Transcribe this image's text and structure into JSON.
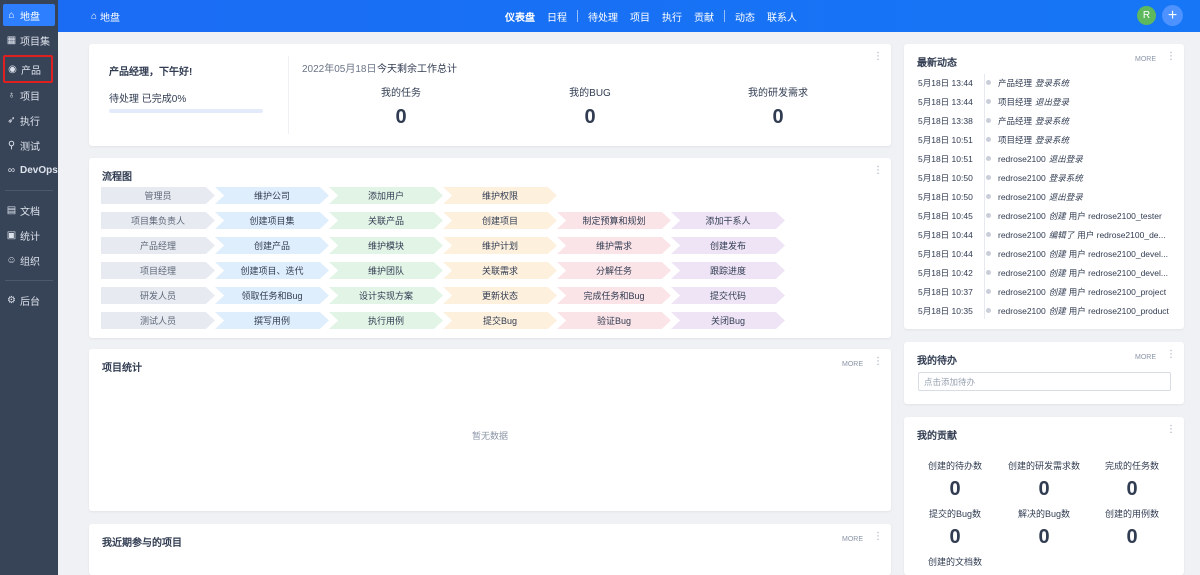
{
  "sidebar": {
    "items": [
      {
        "label": "地盘",
        "icon": "home-icon"
      },
      {
        "label": "项目集",
        "icon": "grid-icon"
      },
      {
        "label": "产品",
        "icon": "location-icon"
      },
      {
        "label": "项目",
        "icon": "bell-icon"
      },
      {
        "label": "执行",
        "icon": "rocket-icon"
      },
      {
        "label": "测试",
        "icon": "search-icon"
      },
      {
        "label": "DevOps",
        "icon": "infinity-icon"
      },
      {
        "label": "文档",
        "icon": "document-icon"
      },
      {
        "label": "统计",
        "icon": "chart-icon"
      },
      {
        "label": "组织",
        "icon": "people-icon"
      },
      {
        "label": "后台",
        "icon": "gear-icon"
      }
    ]
  },
  "topbar": {
    "crumb": "地盘",
    "nav": [
      "仪表盘",
      "日程",
      "待处理",
      "项目",
      "执行",
      "贡献",
      "动态",
      "联系人"
    ],
    "active_nav": "仪表盘",
    "avatar": "R",
    "plus": "+"
  },
  "welcome": {
    "greeting": "产品经理，下午好!",
    "todo_progress": "待处理 已完成0%",
    "date": "2022年05月18日",
    "date_note": "今天剩余工作总计",
    "stats": [
      {
        "label": "我的任务",
        "value": "0"
      },
      {
        "label": "我的BUG",
        "value": "0"
      },
      {
        "label": "我的研发需求",
        "value": "0"
      }
    ]
  },
  "flow": {
    "title": "流程图",
    "rows": [
      [
        "管理员",
        "维护公司",
        "添加用户",
        "维护权限"
      ],
      [
        "项目集负责人",
        "创建项目集",
        "关联产品",
        "创建项目",
        "制定预算和规划",
        "添加干系人"
      ],
      [
        "产品经理",
        "创建产品",
        "维护模块",
        "维护计划",
        "维护需求",
        "创建发布"
      ],
      [
        "项目经理",
        "创建项目、迭代",
        "维护团队",
        "关联需求",
        "分解任务",
        "跟踪进度"
      ],
      [
        "研发人员",
        "领取任务和Bug",
        "设计实现方案",
        "更新状态",
        "完成任务和Bug",
        "提交代码"
      ],
      [
        "测试人员",
        "撰写用例",
        "执行用例",
        "提交Bug",
        "验证Bug",
        "关闭Bug"
      ]
    ]
  },
  "project_stats": {
    "title": "项目统计",
    "more": "MORE",
    "empty": "暂无数据"
  },
  "recent_projects": {
    "title": "我近期参与的项目",
    "more": "MORE"
  },
  "dynamics": {
    "title": "最新动态",
    "more": "MORE",
    "items": [
      {
        "time": "5月18日 13:44",
        "who": "产品经理",
        "action": "登录系统",
        "object": ""
      },
      {
        "time": "5月18日 13:44",
        "who": "项目经理",
        "action": "退出登录",
        "object": ""
      },
      {
        "time": "5月18日 13:38",
        "who": "产品经理",
        "action": "登录系统",
        "object": ""
      },
      {
        "time": "5月18日 10:51",
        "who": "项目经理",
        "action": "登录系统",
        "object": ""
      },
      {
        "time": "5月18日 10:51",
        "who": "redrose2100",
        "action": "退出登录",
        "object": ""
      },
      {
        "time": "5月18日 10:50",
        "who": "redrose2100",
        "action": "登录系统",
        "object": ""
      },
      {
        "time": "5月18日 10:50",
        "who": "redrose2100",
        "action": "退出登录",
        "object": ""
      },
      {
        "time": "5月18日 10:45",
        "who": "redrose2100",
        "action": "创建",
        "object": "用户 redrose2100_tester"
      },
      {
        "time": "5月18日 10:44",
        "who": "redrose2100",
        "action": "编辑了",
        "object": "用户 redrose2100_de..."
      },
      {
        "time": "5月18日 10:44",
        "who": "redrose2100",
        "action": "创建",
        "object": "用户 redrose2100_devel..."
      },
      {
        "time": "5月18日 10:42",
        "who": "redrose2100",
        "action": "创建",
        "object": "用户 redrose2100_devel..."
      },
      {
        "time": "5月18日 10:37",
        "who": "redrose2100",
        "action": "创建",
        "object": "用户 redrose2100_project"
      },
      {
        "time": "5月18日 10:35",
        "who": "redrose2100",
        "action": "创建",
        "object": "用户 redrose2100_product"
      }
    ]
  },
  "todo": {
    "title": "我的待办",
    "more": "MORE",
    "placeholder": "点击添加待办"
  },
  "contribution": {
    "title": "我的贡献",
    "items": [
      {
        "label": "创建的待办数",
        "value": "0"
      },
      {
        "label": "创建的研发需求数",
        "value": "0"
      },
      {
        "label": "完成的任务数",
        "value": "0"
      },
      {
        "label": "提交的Bug数",
        "value": "0"
      },
      {
        "label": "解决的Bug数",
        "value": "0"
      },
      {
        "label": "创建的用例数",
        "value": "0"
      },
      {
        "label": "创建的文档数",
        "value": ""
      }
    ]
  }
}
